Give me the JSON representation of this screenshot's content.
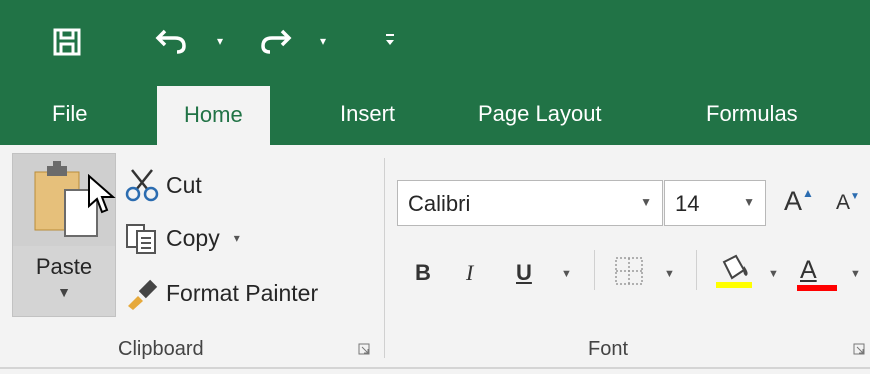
{
  "quick_access": {
    "save_icon": "save-icon",
    "undo_icon": "undo-icon",
    "redo_icon": "redo-icon",
    "customize_icon": "customize-qat-icon",
    "dropdown_glyph": "▾"
  },
  "tabs": [
    {
      "label": "File",
      "active": false
    },
    {
      "label": "Home",
      "active": true
    },
    {
      "label": "Insert",
      "active": false
    },
    {
      "label": "Page Layout",
      "active": false
    },
    {
      "label": "Formulas",
      "active": false
    }
  ],
  "clipboard": {
    "paste_label": "Paste",
    "cut_label": "Cut",
    "copy_label": "Copy",
    "format_painter_label": "Format Painter",
    "group_label": "Clipboard"
  },
  "font": {
    "font_name": "Calibri",
    "font_size": "14",
    "grow_font": "A",
    "shrink_font": "A",
    "bold": "B",
    "italic": "I",
    "underline": "U",
    "font_color_letter": "A",
    "group_label": "Font",
    "fill_color": "#ffff00",
    "font_color": "#ff0000"
  },
  "colors": {
    "accent": "#217346",
    "ribbon_bg": "#f3f3f3"
  }
}
